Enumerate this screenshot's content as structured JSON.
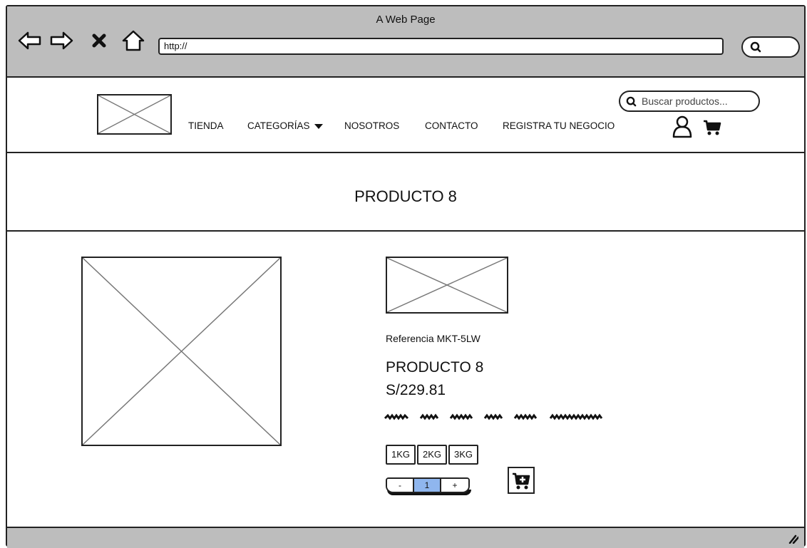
{
  "browser": {
    "title": "A Web Page",
    "url": "http://"
  },
  "header": {
    "nav": [
      {
        "label": "TIENDA"
      },
      {
        "label": "CATEGORÍAS"
      },
      {
        "label": "NOSOTROS"
      },
      {
        "label": "CONTACTO"
      },
      {
        "label": "REGISTRA TU NEGOCIO"
      }
    ],
    "search_placeholder": "Buscar productos..."
  },
  "page": {
    "title": "PRODUCTO 8"
  },
  "product": {
    "reference": "Referencia MKT-5LW",
    "name": "PRODUCTO 8",
    "price": "S/229.81",
    "sizes": [
      "1KG",
      "2KG",
      "3KG"
    ],
    "quantity_minus": "-",
    "quantity": "1",
    "quantity_plus": "+"
  },
  "icons": {
    "back": "arrow-left-icon",
    "forward": "arrow-right-icon",
    "stop": "close-icon",
    "home": "home-icon",
    "search": "search-icon",
    "user": "user-icon",
    "cart": "cart-icon",
    "add_to_cart": "cart-plus-icon",
    "resize": "resize-grip-icon"
  },
  "colors": {
    "chrome": "#bdbdbd",
    "quantity_highlight": "#8fb6ee"
  }
}
